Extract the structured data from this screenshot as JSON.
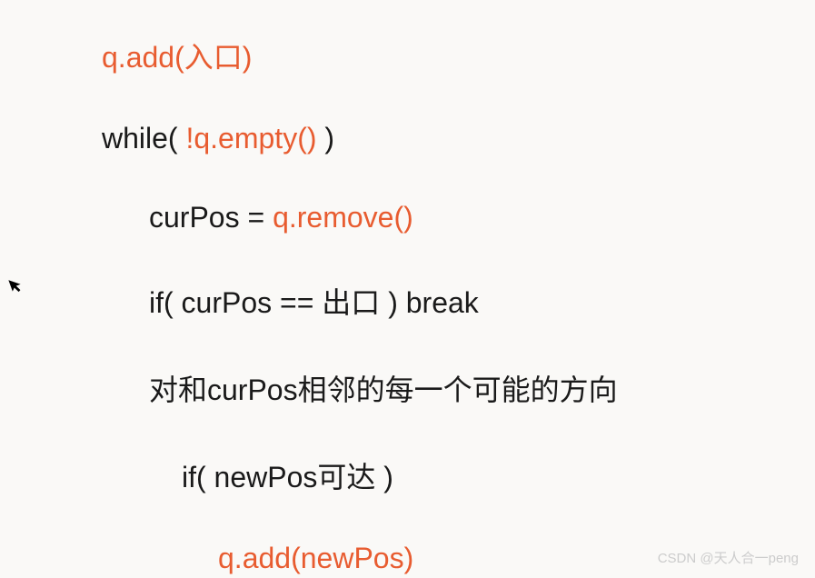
{
  "code": {
    "line1": {
      "h1": "q.add(入口)"
    },
    "line2": {
      "n1": "while( ",
      "h1": "!q.empty()",
      "n2": " )"
    },
    "line3": {
      "n1": "curPos = ",
      "h1": "q.remove()"
    },
    "line4": {
      "n1": "if( curPos == 出口 ) break"
    },
    "line5": {
      "n1": "对和curPos相邻的每一个可能的方向"
    },
    "line6": {
      "n1": "if( newPos可达 )"
    },
    "line7": {
      "h1": "q.add(newPos)"
    }
  },
  "watermark": "CSDN @天人合一peng",
  "cursor_glyph": "➤"
}
